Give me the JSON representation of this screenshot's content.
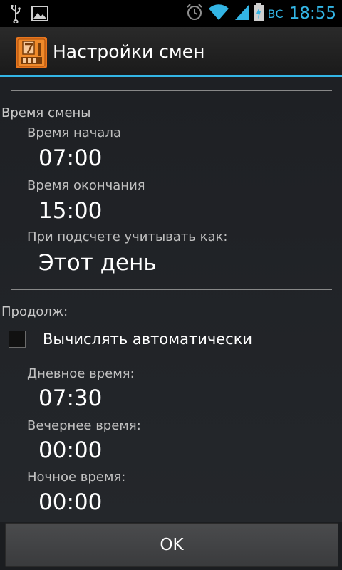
{
  "status_bar": {
    "day": "ВС",
    "time": "18:55",
    "icons": [
      "usb-icon",
      "image-icon",
      "alarm-icon",
      "wifi-icon",
      "signal-icon",
      "battery-charging-icon"
    ],
    "accent_color": "#33b5e5"
  },
  "action_bar": {
    "title": "Настройки смен",
    "app_icon": "calendar-app-icon"
  },
  "shift_time": {
    "section_label": "Время смены",
    "start_label": "Время начала",
    "start_value": "07:00",
    "end_label": "Время окончания",
    "end_value": "15:00",
    "count_as_label": "При подсчете учитывать как:",
    "count_as_value": "Этот день"
  },
  "duration": {
    "section_label": "Продолж:",
    "auto_checkbox_label": "Вычислять автоматически",
    "auto_checked": false,
    "day_label": "Дневное время:",
    "day_value": "07:30",
    "evening_label": "Вечернее время:",
    "evening_value": "00:00",
    "night_label": "Ночное время:",
    "night_value": "00:00"
  },
  "footer": {
    "ok_label": "OK"
  }
}
